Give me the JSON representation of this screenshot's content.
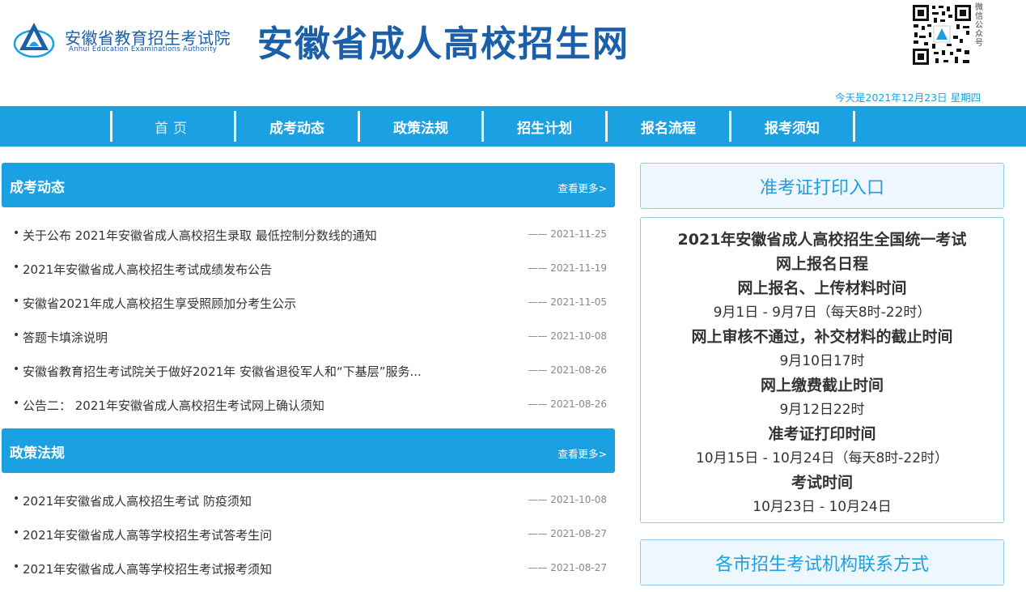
{
  "header": {
    "org_name_cn": "安徽省教育招生考试院",
    "org_name_en": "Anhui Education Examinations Authority",
    "site_title": "安徽省成人高校招生网",
    "qr_caption": "微信公众号",
    "date_text": "今天是2021年12月23日 星期四"
  },
  "nav": {
    "items": [
      "首页",
      "成考动态",
      "政策法规",
      "招生计划",
      "报名流程",
      "报考须知"
    ]
  },
  "news_section": {
    "title": "成考动态",
    "more": "查看更多>",
    "items": [
      {
        "title": "关于公布 2021年安徽省成人高校招生录取 最低控制分数线的通知",
        "date": "—— 2021-11-25"
      },
      {
        "title": "2021年安徽省成人高校招生考试成绩发布公告",
        "date": "—— 2021-11-19"
      },
      {
        "title": "安徽省2021年成人高校招生享受照顾加分考生公示",
        "date": "—— 2021-11-05"
      },
      {
        "title": "答题卡填涂说明",
        "date": "—— 2021-10-08"
      },
      {
        "title": "安徽省教育招生考试院关于做好2021年 安徽省退役军人和“下基层”服务...",
        "date": "—— 2021-08-26"
      },
      {
        "title": "公告二： 2021年安徽省成人高校招生考试网上确认须知",
        "date": "—— 2021-08-26"
      }
    ]
  },
  "policy_section": {
    "title": "政策法规",
    "more": "查看更多>",
    "items": [
      {
        "title": "2021年安徽省成人高校招生考试 防疫须知",
        "date": "—— 2021-10-08"
      },
      {
        "title": "2021年安徽省成人高等学校招生考试答考生问",
        "date": "—— 2021-08-27"
      },
      {
        "title": "2021年安徽省成人高等学校招生考试报考须知",
        "date": "—— 2021-08-27"
      }
    ]
  },
  "sidebar": {
    "print_entry": "准考证打印入口",
    "schedule": {
      "title_line1": "2021年安徽省成人高校招生全国统一考试",
      "title_line2": "网上报名日程",
      "h1": "网上报名、上传材料时间",
      "v1": "9月1日 - 9月7日（每天8时-22时）",
      "h2": "网上审核不通过，补交材料的截止时间",
      "v2": "9月10日17时",
      "h3": "网上缴费截止时间",
      "v3": "9月12日22时",
      "h4": "准考证打印时间",
      "v4": "10月15日 - 10月24日（每天8时-22时）",
      "h5": "考试时间",
      "v5": "10月23日 - 10月24日"
    },
    "contact": "各市招生考试机构联系方式"
  },
  "colors": {
    "brand_blue": "#1ba1e2",
    "title_blue": "#1a5fa8"
  }
}
